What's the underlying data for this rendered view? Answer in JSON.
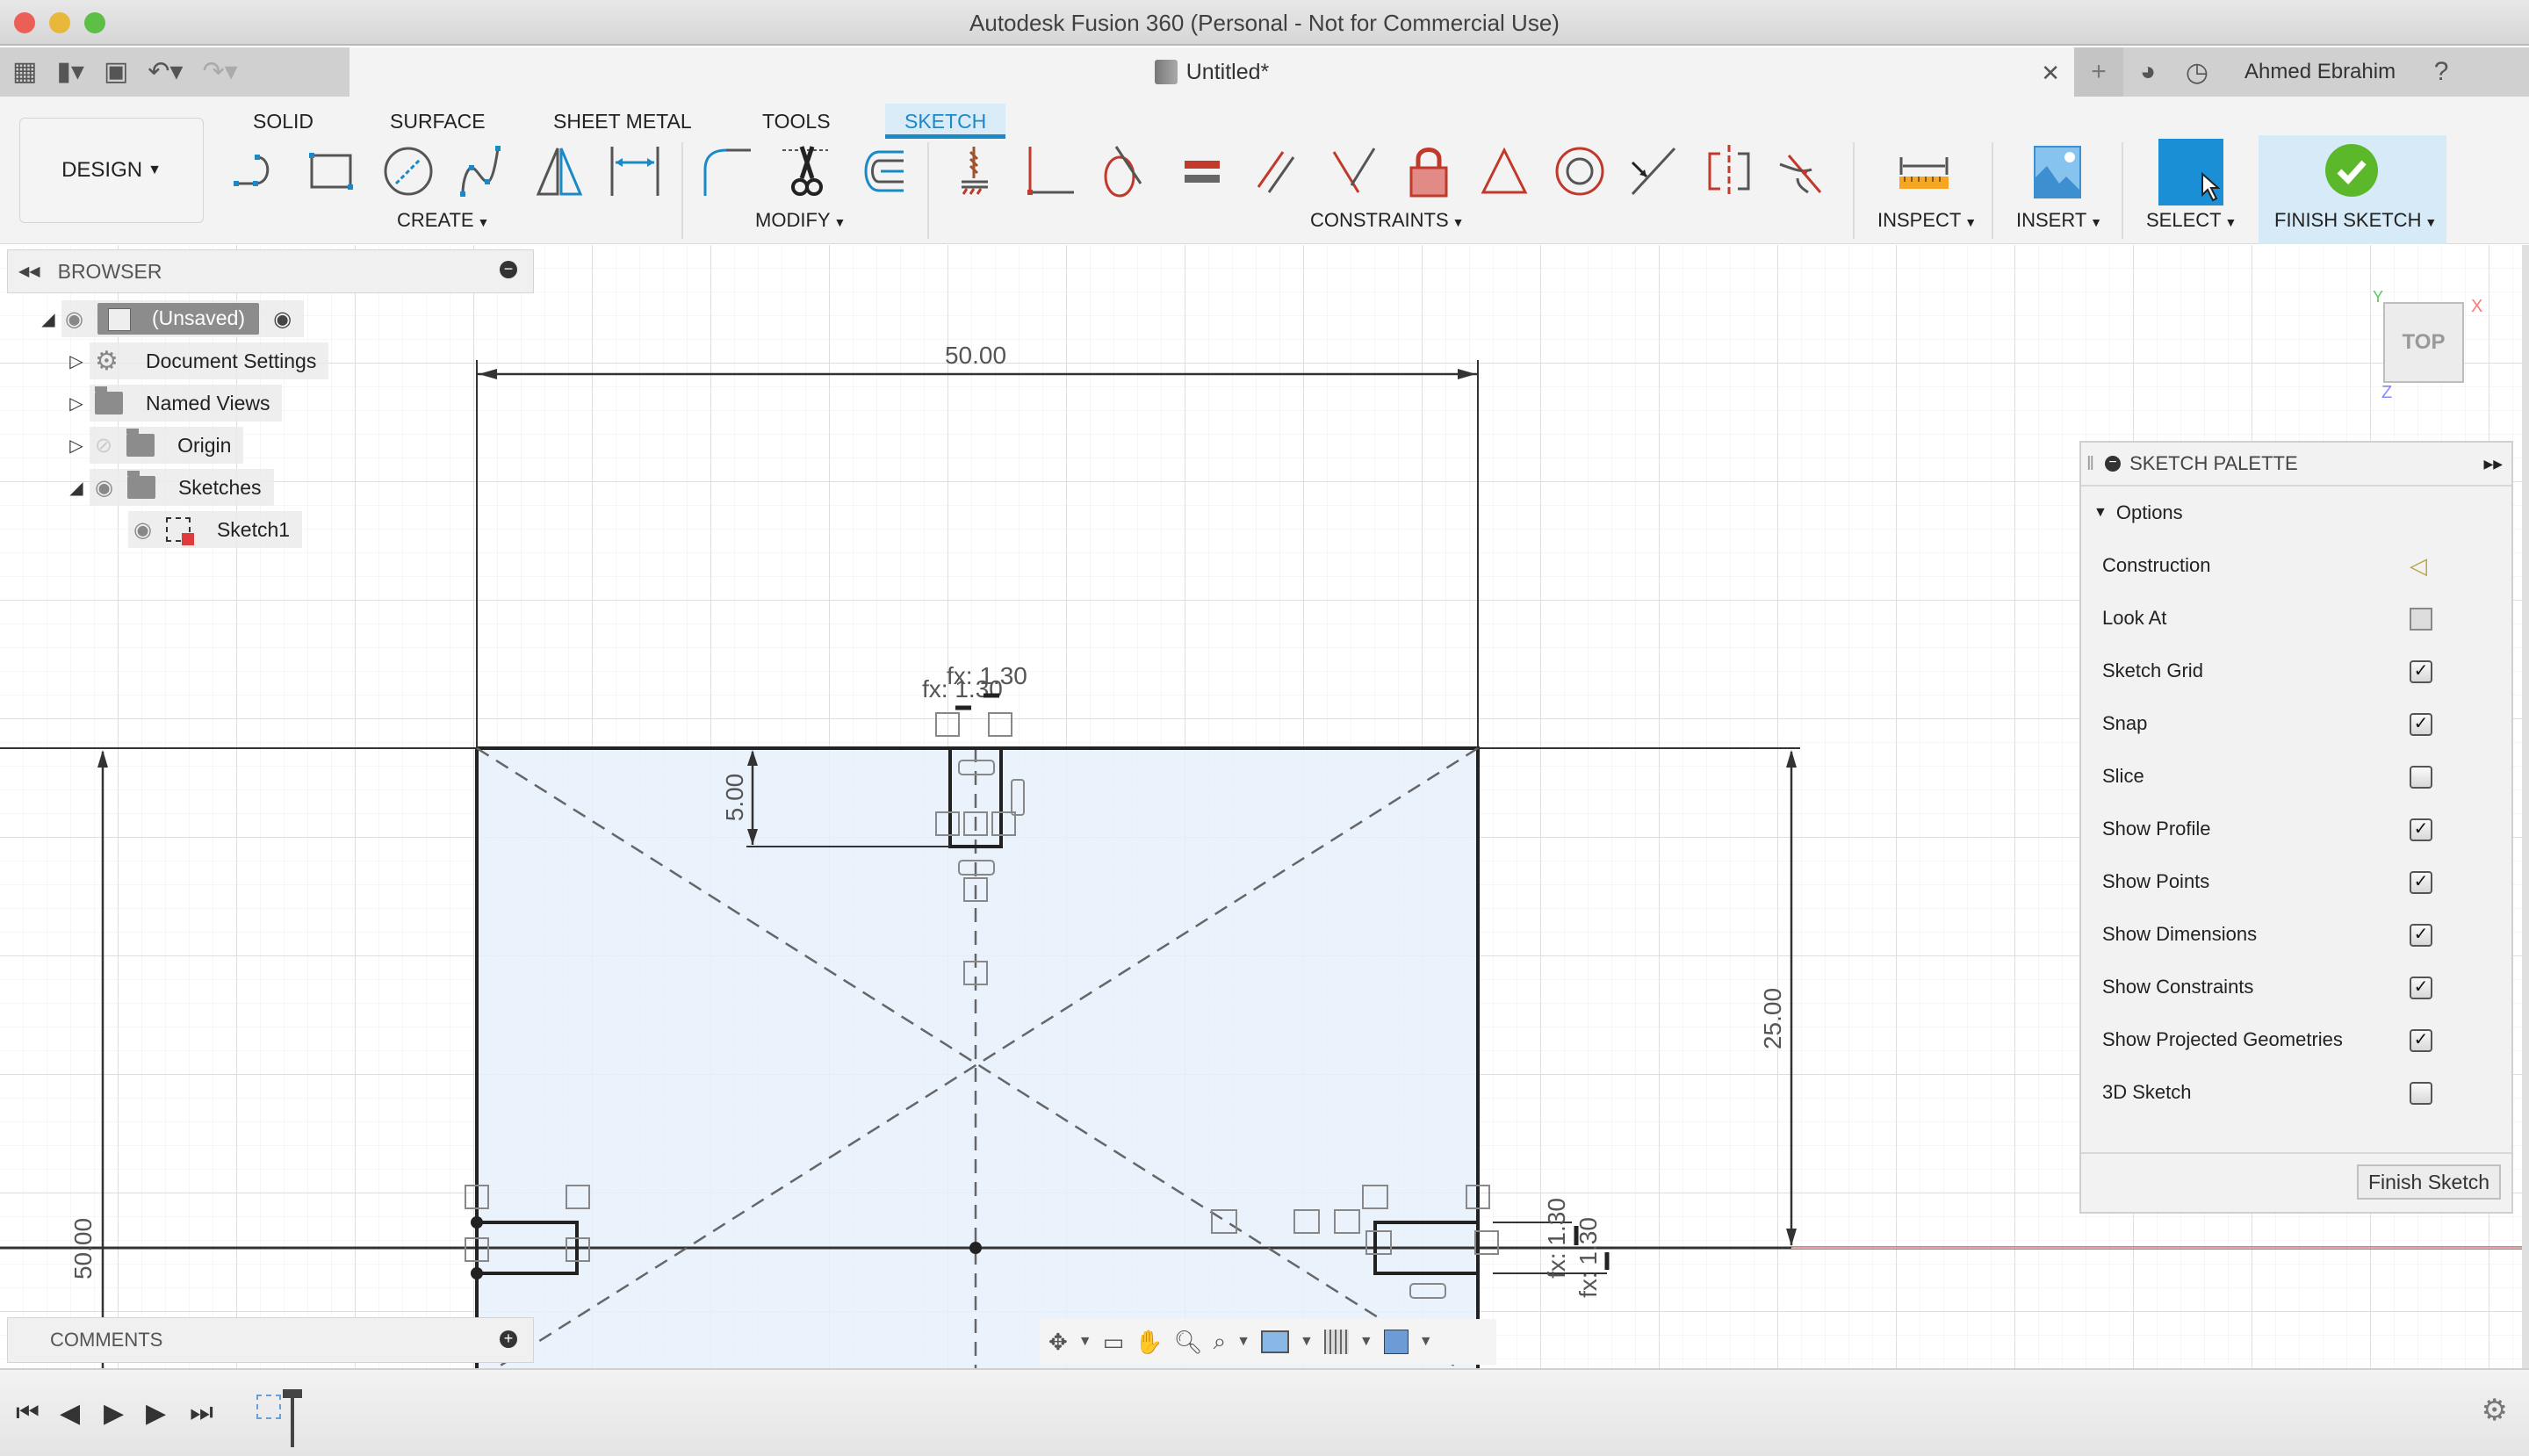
{
  "window": {
    "title": "Autodesk Fusion 360 (Personal - Not for Commercial Use)"
  },
  "document_tab": {
    "title": "Untitled*",
    "close_icon": "close-icon"
  },
  "user": {
    "name": "Ahmed Ebrahim"
  },
  "quick_access": [
    "grid-menu-icon",
    "file-icon",
    "save-icon",
    "undo-icon",
    "redo-icon"
  ],
  "ribbon": {
    "workspace_label": "DESIGN",
    "tabs": [
      {
        "label": "SOLID",
        "active": false
      },
      {
        "label": "SURFACE",
        "active": false
      },
      {
        "label": "SHEET METAL",
        "active": false
      },
      {
        "label": "TOOLS",
        "active": false
      },
      {
        "label": "SKETCH",
        "active": true
      }
    ],
    "groups": {
      "create": "CREATE",
      "modify": "MODIFY",
      "constraints": "CONSTRAINTS",
      "inspect": "INSPECT",
      "insert": "INSERT",
      "select": "SELECT",
      "finish": "FINISH SKETCH"
    },
    "create_tools": [
      "line-icon",
      "rectangle-icon",
      "circle-icon",
      "spline-icon",
      "mirror-icon",
      "dimension-icon"
    ],
    "modify_tools": [
      "fillet-icon",
      "trim-icon",
      "offset-icon"
    ],
    "constraint_tools": [
      "fix-icon",
      "coincident-icon",
      "tangent-icon",
      "equal-icon",
      "parallel-icon",
      "perpendicular-icon",
      "lock-icon",
      "midpoint-icon",
      "concentric-icon",
      "collinear-icon",
      "symmetry-icon",
      "curvature-icon"
    ]
  },
  "browser": {
    "title": "BROWSER",
    "items": [
      {
        "label": "(Unsaved)",
        "level": 0,
        "expanded": true
      },
      {
        "label": "Document Settings",
        "level": 1,
        "expanded": false
      },
      {
        "label": "Named Views",
        "level": 1,
        "expanded": false
      },
      {
        "label": "Origin",
        "level": 1,
        "expanded": false
      },
      {
        "label": "Sketches",
        "level": 1,
        "expanded": true
      },
      {
        "label": "Sketch1",
        "level": 2
      }
    ]
  },
  "comments": {
    "title": "COMMENTS"
  },
  "viewcube": {
    "face": "TOP",
    "axes": {
      "x": "X",
      "y": "Y",
      "z": "Z"
    }
  },
  "sketch": {
    "dimensions": {
      "width": "50.00",
      "height": "25.00",
      "left_offset": "50.00",
      "slot_depth": "5.00",
      "fx_top_a": "fx: 1.30",
      "fx_top_b": "fx: 1.30",
      "fx_right_a": "fx: 1.30",
      "fx_right_b": "fx: 1.30"
    }
  },
  "palette": {
    "title": "SKETCH PALETTE",
    "section": "Options",
    "options": [
      {
        "label": "Construction",
        "type": "icon",
        "icon": "construction-icon"
      },
      {
        "label": "Look At",
        "type": "icon",
        "icon": "look-at-icon"
      },
      {
        "label": "Sketch Grid",
        "type": "checkbox",
        "checked": true
      },
      {
        "label": "Snap",
        "type": "checkbox",
        "checked": true
      },
      {
        "label": "Slice",
        "type": "checkbox",
        "checked": false
      },
      {
        "label": "Show Profile",
        "type": "checkbox",
        "checked": true
      },
      {
        "label": "Show Points",
        "type": "checkbox",
        "checked": true
      },
      {
        "label": "Show Dimensions",
        "type": "checkbox",
        "checked": true
      },
      {
        "label": "Show Constraints",
        "type": "checkbox",
        "checked": true
      },
      {
        "label": "Show Projected Geometries",
        "type": "checkbox",
        "checked": true
      },
      {
        "label": "3D Sketch",
        "type": "checkbox",
        "checked": false
      }
    ],
    "finish_button": "Finish Sketch"
  },
  "colors": {
    "accent": "#1a8ac6",
    "constraint_red": "#c0392b",
    "finish_green": "#5cb82b",
    "profile_fill": "#e6f0fa"
  }
}
